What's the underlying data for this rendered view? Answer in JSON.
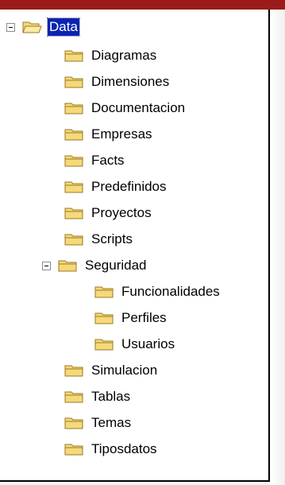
{
  "colors": {
    "header_bar": "#9b1b1b",
    "selection": "#0a24b4",
    "folder_fill": "#f5d97a",
    "folder_outline": "#9a7a20"
  },
  "icons": {
    "folder": "folder-icon",
    "expander": "collapse-minus-icon"
  },
  "tree": {
    "root": {
      "label": "Data",
      "expanded": true,
      "selected": true
    },
    "items": [
      {
        "label": "Diagramas"
      },
      {
        "label": "Dimensiones"
      },
      {
        "label": "Documentacion"
      },
      {
        "label": "Empresas"
      },
      {
        "label": "Facts"
      },
      {
        "label": "Predefinidos"
      },
      {
        "label": "Proyectos"
      },
      {
        "label": "Scripts"
      },
      {
        "label": "Seguridad",
        "expanded": true
      },
      {
        "label": "Funcionalidades"
      },
      {
        "label": "Perfiles"
      },
      {
        "label": "Usuarios"
      },
      {
        "label": "Simulacion"
      },
      {
        "label": "Tablas"
      },
      {
        "label": "Temas"
      },
      {
        "label": "Tiposdatos"
      }
    ]
  }
}
